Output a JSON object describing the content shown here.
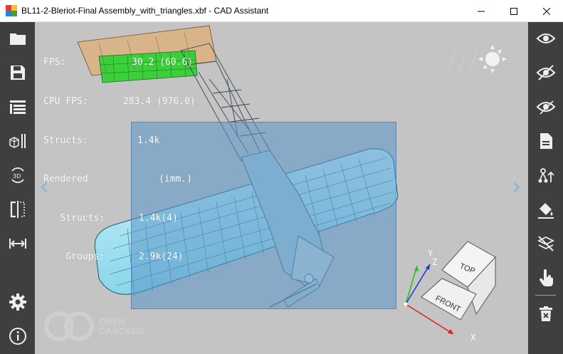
{
  "window": {
    "title": "BL11-2-Bleriot-Final Assembly_with_triangles.xbf - CAD Assistant"
  },
  "stats": [
    {
      "label": "FPS:",
      "value": "30.2 (60.6)"
    },
    {
      "label": "CPU FPS:",
      "value": "283.4 (976.0)"
    },
    {
      "label": "Structs:",
      "value": "1.4k"
    },
    {
      "label": "Rendered",
      "value": "(imm.)"
    },
    {
      "label": "   Structs:",
      "value": "1.4k(4)"
    },
    {
      "label": "    Groups:",
      "value": "2.9k(24)"
    }
  ],
  "viewcube": {
    "top_label": "TOP",
    "front_label": "FRONT",
    "axis_x": "X",
    "axis_y": "Y",
    "axis_z": "Z"
  },
  "logo": {
    "line1": "OPEN",
    "line2": "CASCADE"
  },
  "colors": {
    "toolbar_bg": "#3f3f3f",
    "viewport_bg": "#c4c4c4",
    "selection_fill": "#5a96c8",
    "wing_fill": "#a6e3f2",
    "tail_fill": "#33cc33"
  },
  "left_toolbar": [
    "folder-icon",
    "save-icon",
    "model-tree-icon",
    "explode-view-icon",
    "rotate-3d-icon",
    "split-view-icon",
    "measure-icon",
    "settings-icon",
    "info-icon"
  ],
  "right_toolbar": [
    "show-icon",
    "hide-icon",
    "show-only-icon",
    "properties-icon",
    "graph-icon",
    "paint-bucket-icon",
    "clipping-plane-icon",
    "pick-hand-icon",
    "delete-icon"
  ]
}
